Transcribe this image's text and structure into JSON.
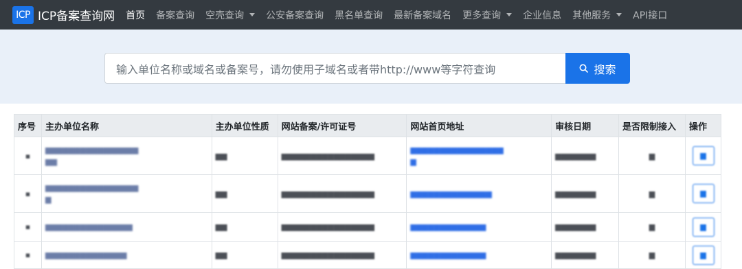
{
  "brand": {
    "logo": "ICP",
    "title": "ICP备案查询网"
  },
  "nav": [
    {
      "label": "首页",
      "active": true,
      "dropdown": false
    },
    {
      "label": "备案查询",
      "active": false,
      "dropdown": false
    },
    {
      "label": "空壳查询",
      "active": false,
      "dropdown": true
    },
    {
      "label": "公安备案查询",
      "active": false,
      "dropdown": false
    },
    {
      "label": "黑名单查询",
      "active": false,
      "dropdown": false
    },
    {
      "label": "最新备案域名",
      "active": false,
      "dropdown": false
    },
    {
      "label": "更多查询",
      "active": false,
      "dropdown": true
    },
    {
      "label": "企业信息",
      "active": false,
      "dropdown": false
    },
    {
      "label": "其他服务",
      "active": false,
      "dropdown": true
    },
    {
      "label": "API接口",
      "active": false,
      "dropdown": false
    }
  ],
  "search": {
    "placeholder": "输入单位名称或域名或备案号，请勿使用子域名或者带http://www等字符查询",
    "button_label": "搜索"
  },
  "table": {
    "headers": [
      "序号",
      "主办单位名称",
      "主办单位性质",
      "网站备案/许可证号",
      "网站首页地址",
      "审核日期",
      "是否限制接入",
      "操作"
    ]
  },
  "colors": {
    "nav_bg": "#343a40",
    "accent": "#1a73e8",
    "hero_bg": "#e9f0f9"
  }
}
